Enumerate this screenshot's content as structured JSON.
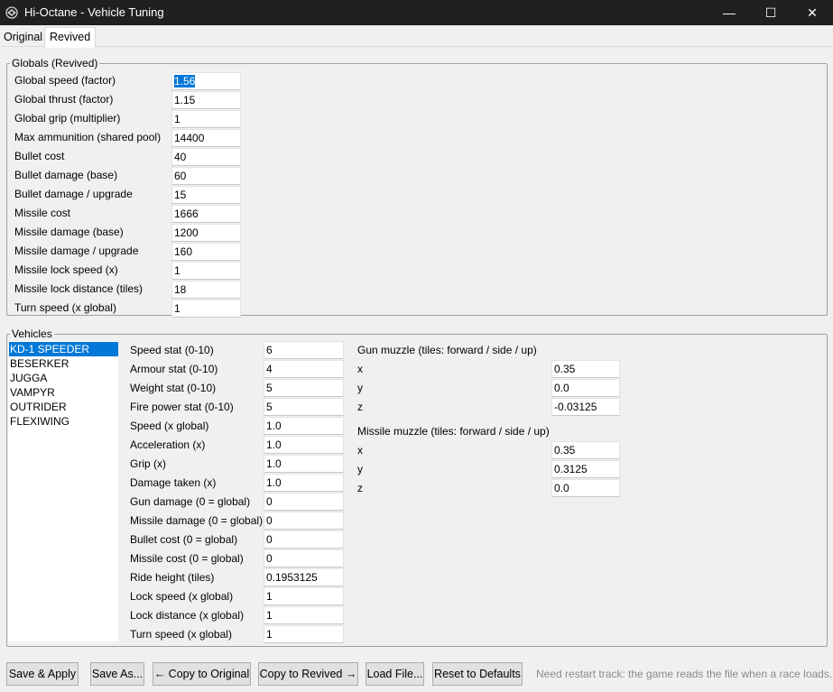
{
  "window": {
    "title": "Hi-Octane - Vehicle Tuning",
    "icon": "app-logo-icon",
    "minimize_glyph": "—",
    "maximize_glyph": "☐",
    "close_glyph": "✕"
  },
  "tabs": [
    {
      "label": "Original",
      "selected": false
    },
    {
      "label": "Revived",
      "selected": true
    }
  ],
  "globals": {
    "legend": "Globals (Revived)",
    "fields": [
      {
        "label": "Global speed (factor)",
        "value": "1.56"
      },
      {
        "label": "Global thrust (factor)",
        "value": "1.15"
      },
      {
        "label": "Global grip (multiplier)",
        "value": "1"
      },
      {
        "label": "Max ammunition (shared pool)",
        "value": "14400"
      },
      {
        "label": "Bullet cost",
        "value": "40"
      },
      {
        "label": "Bullet damage (base)",
        "value": "60"
      },
      {
        "label": "Bullet damage / upgrade",
        "value": "15"
      },
      {
        "label": "Missile cost",
        "value": "1666"
      },
      {
        "label": "Missile damage (base)",
        "value": "1200"
      },
      {
        "label": "Missile damage / upgrade",
        "value": "160"
      },
      {
        "label": "Missile lock speed (x)",
        "value": "1"
      },
      {
        "label": "Missile lock distance (tiles)",
        "value": "18"
      },
      {
        "label": "Turn speed (x global)",
        "value": "1"
      }
    ]
  },
  "vehicles": {
    "legend": "Vehicles",
    "list": [
      "KD-1 SPEEDER",
      "BESERKER",
      "JUGGA",
      "VAMPYR",
      "OUTRIDER",
      "FLEXIWING"
    ],
    "selected": "KD-1 SPEEDER",
    "stats": [
      {
        "label": "Speed stat (0-10)",
        "value": "6"
      },
      {
        "label": "Armour stat (0-10)",
        "value": "4"
      },
      {
        "label": "Weight stat (0-10)",
        "value": "5"
      },
      {
        "label": "Fire power stat (0-10)",
        "value": "5"
      },
      {
        "label": "Speed (x global)",
        "value": "1.0"
      },
      {
        "label": "Acceleration (x)",
        "value": "1.0"
      },
      {
        "label": "Grip (x)",
        "value": "1.0"
      },
      {
        "label": "Damage taken (x)",
        "value": "1.0"
      },
      {
        "label": "Gun damage (0 = global)",
        "value": "0"
      },
      {
        "label": "Missile damage (0 = global)",
        "value": "0"
      },
      {
        "label": "Bullet cost (0 = global)",
        "value": "0"
      },
      {
        "label": "Missile cost (0 = global)",
        "value": "0"
      },
      {
        "label": "Ride height (tiles)",
        "value": "0.1953125"
      },
      {
        "label": "Lock speed (x global)",
        "value": "1"
      },
      {
        "label": "Lock distance (x global)",
        "value": "1"
      },
      {
        "label": "Turn speed (x global)",
        "value": "1"
      }
    ],
    "gun_muzzle": {
      "title": "Gun muzzle (tiles: forward / side / up)",
      "fields": [
        {
          "label": "x",
          "value": "0.35"
        },
        {
          "label": "y",
          "value": "0.0"
        },
        {
          "label": "z",
          "value": "-0.03125"
        }
      ]
    },
    "missile_muzzle": {
      "title": "Missile muzzle (tiles: forward / side / up)",
      "fields": [
        {
          "label": "x",
          "value": "0.35"
        },
        {
          "label": "y",
          "value": "0.3125"
        },
        {
          "label": "z",
          "value": "0.0"
        }
      ]
    }
  },
  "buttons": {
    "save_apply": "Save & Apply",
    "save_as": "Save As...",
    "copy_to_original": "← Copy to Original",
    "copy_to_revived": "Copy to Revived →",
    "load_file": "Load File...",
    "reset_defaults": "Reset to Defaults"
  },
  "status": "Need restart track: the game reads the file when a race loads.",
  "colors": {
    "titlebar": "#202020",
    "selection": "#0078d7",
    "window_bg": "#f0f0f0",
    "status_text": "#8a8a8a"
  }
}
